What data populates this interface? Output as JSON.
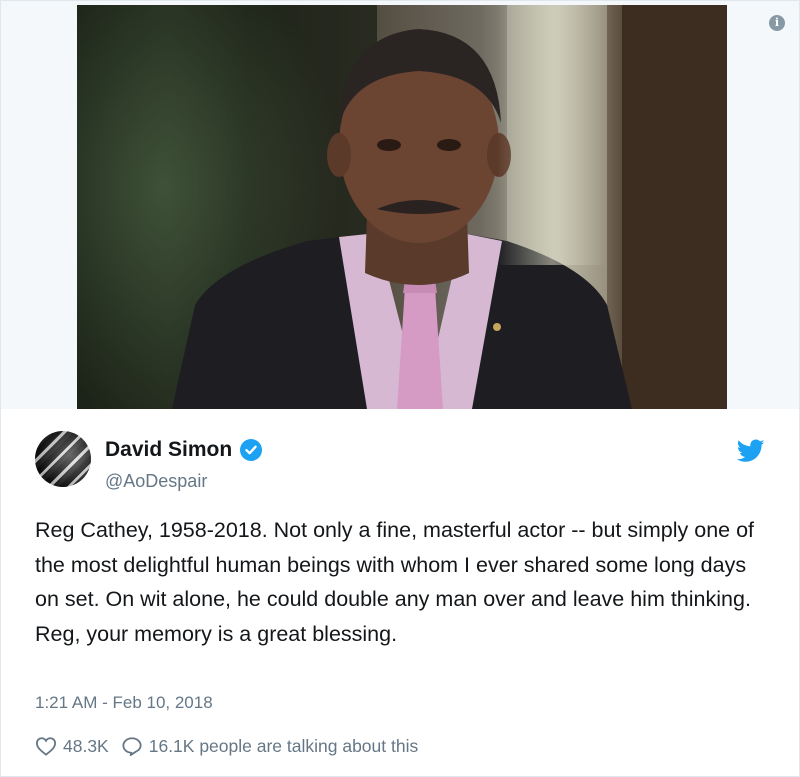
{
  "media": {
    "photo_label": "Reg Cathey portrait",
    "info_icon": "info-icon"
  },
  "author": {
    "display_name": "David Simon",
    "handle": "@AoDespair",
    "verified": true
  },
  "tweet": {
    "text": "Reg Cathey, 1958-2018.  Not only a fine, masterful actor -- but simply one of the most delightful human beings with whom I ever shared some long days on set. On wit alone, he could double any man over and leave him thinking. Reg, your memory is a great blessing.",
    "timestamp": "1:21 AM - Feb 10, 2018"
  },
  "actions": {
    "likes": "48.3K",
    "replies_text": "16.1K people are talking about this"
  },
  "colors": {
    "accent": "#1da1f2",
    "secondary_text": "#657786",
    "primary_text": "#14171a"
  }
}
